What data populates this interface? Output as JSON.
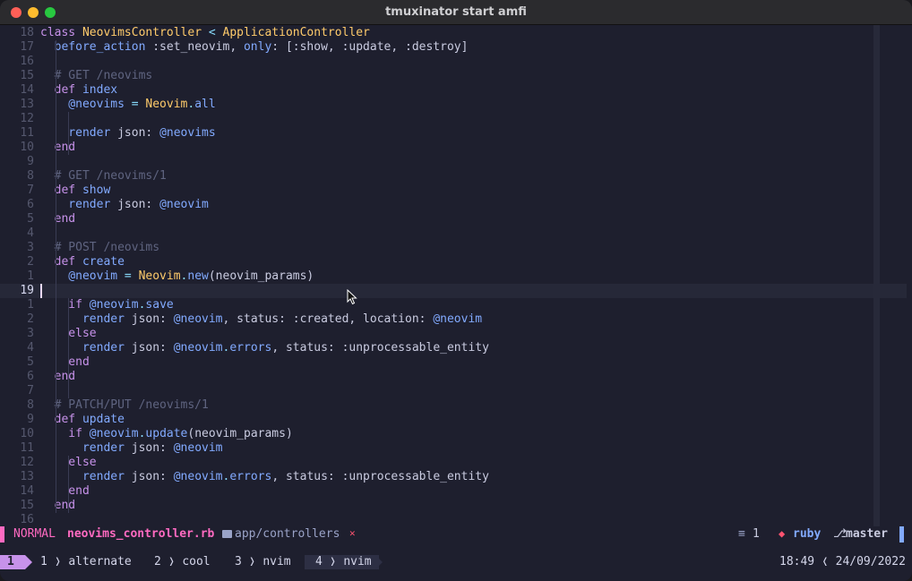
{
  "window": {
    "title": "tmuxinator start amfi"
  },
  "editor": {
    "lines": [
      {
        "num": "18",
        "parts": [
          [
            "kw",
            "class "
          ],
          [
            "cls",
            "NeovimsController "
          ],
          [
            "op",
            "< "
          ],
          [
            "cls",
            "ApplicationController"
          ]
        ]
      },
      {
        "num": "17",
        "parts": [
          [
            "plain",
            "  "
          ],
          [
            "meth",
            "before_action "
          ],
          [
            "sym",
            ":set_neovim"
          ],
          [
            "plain",
            ", "
          ],
          [
            "meth",
            "only"
          ],
          [
            "plain",
            ": [:show, :update, :destroy]"
          ]
        ]
      },
      {
        "num": "16",
        "parts": []
      },
      {
        "num": "15",
        "parts": [
          [
            "cmt",
            "  # GET /neovims"
          ]
        ]
      },
      {
        "num": "14",
        "parts": [
          [
            "kw",
            "  def "
          ],
          [
            "meth",
            "index"
          ]
        ]
      },
      {
        "num": "13",
        "parts": [
          [
            "ivar",
            "    @neovims "
          ],
          [
            "op",
            "= "
          ],
          [
            "cls",
            "Neovim"
          ],
          [
            "op",
            "."
          ],
          [
            "meth",
            "all"
          ]
        ]
      },
      {
        "num": "12",
        "parts": []
      },
      {
        "num": "11",
        "parts": [
          [
            "meth",
            "    render "
          ],
          [
            "plain",
            "json: "
          ],
          [
            "ivar",
            "@neovims"
          ]
        ]
      },
      {
        "num": "10",
        "parts": [
          [
            "kw",
            "  end"
          ]
        ]
      },
      {
        "num": "9",
        "parts": []
      },
      {
        "num": "8",
        "parts": [
          [
            "cmt",
            "  # GET /neovims/1"
          ]
        ]
      },
      {
        "num": "7",
        "parts": [
          [
            "kw",
            "  def "
          ],
          [
            "meth",
            "show"
          ]
        ]
      },
      {
        "num": "6",
        "parts": [
          [
            "meth",
            "    render "
          ],
          [
            "plain",
            "json: "
          ],
          [
            "ivar",
            "@neovim"
          ]
        ]
      },
      {
        "num": "5",
        "parts": [
          [
            "kw",
            "  end"
          ]
        ]
      },
      {
        "num": "4",
        "parts": []
      },
      {
        "num": "3",
        "parts": [
          [
            "cmt",
            "  # POST /neovims"
          ]
        ]
      },
      {
        "num": "2",
        "parts": [
          [
            "kw",
            "  def "
          ],
          [
            "meth",
            "create"
          ]
        ]
      },
      {
        "num": "1",
        "parts": [
          [
            "ivar",
            "    @neovim "
          ],
          [
            "op",
            "= "
          ],
          [
            "cls",
            "Neovim"
          ],
          [
            "op",
            "."
          ],
          [
            "meth",
            "new"
          ],
          [
            "plain",
            "(neovim_params)"
          ]
        ]
      },
      {
        "num": "19",
        "parts": [],
        "current": true
      },
      {
        "num": "1",
        "parts": [
          [
            "kw",
            "    if "
          ],
          [
            "ivar",
            "@neovim"
          ],
          [
            "op",
            "."
          ],
          [
            "meth",
            "save"
          ]
        ]
      },
      {
        "num": "2",
        "parts": [
          [
            "meth",
            "      render "
          ],
          [
            "plain",
            "json: "
          ],
          [
            "ivar",
            "@neovim"
          ],
          [
            "plain",
            ", status: :created, location: "
          ],
          [
            "ivar",
            "@neovim"
          ]
        ]
      },
      {
        "num": "3",
        "parts": [
          [
            "kw",
            "    else"
          ]
        ]
      },
      {
        "num": "4",
        "parts": [
          [
            "meth",
            "      render "
          ],
          [
            "plain",
            "json: "
          ],
          [
            "ivar",
            "@neovim"
          ],
          [
            "op",
            "."
          ],
          [
            "meth",
            "errors"
          ],
          [
            "plain",
            ", status: :unprocessable_entity"
          ]
        ]
      },
      {
        "num": "5",
        "parts": [
          [
            "kw",
            "    end"
          ]
        ]
      },
      {
        "num": "6",
        "parts": [
          [
            "kw",
            "  end"
          ]
        ]
      },
      {
        "num": "7",
        "parts": []
      },
      {
        "num": "8",
        "parts": [
          [
            "cmt",
            "  # PATCH/PUT /neovims/1"
          ]
        ]
      },
      {
        "num": "9",
        "parts": [
          [
            "kw",
            "  def "
          ],
          [
            "meth",
            "update"
          ]
        ]
      },
      {
        "num": "10",
        "parts": [
          [
            "kw",
            "    if "
          ],
          [
            "ivar",
            "@neovim"
          ],
          [
            "op",
            "."
          ],
          [
            "meth",
            "update"
          ],
          [
            "plain",
            "(neovim_params)"
          ]
        ]
      },
      {
        "num": "11",
        "parts": [
          [
            "meth",
            "      render "
          ],
          [
            "plain",
            "json: "
          ],
          [
            "ivar",
            "@neovim"
          ]
        ]
      },
      {
        "num": "12",
        "parts": [
          [
            "kw",
            "    else"
          ]
        ]
      },
      {
        "num": "13",
        "parts": [
          [
            "meth",
            "      render "
          ],
          [
            "plain",
            "json: "
          ],
          [
            "ivar",
            "@neovim"
          ],
          [
            "op",
            "."
          ],
          [
            "meth",
            "errors"
          ],
          [
            "plain",
            ", status: :unprocessable_entity"
          ]
        ]
      },
      {
        "num": "14",
        "parts": [
          [
            "kw",
            "    end"
          ]
        ]
      },
      {
        "num": "15",
        "parts": [
          [
            "kw",
            "  end"
          ]
        ]
      },
      {
        "num": "16",
        "parts": []
      }
    ]
  },
  "statusline": {
    "mode": "NORMAL",
    "filename": "neovims_controller.rb",
    "path": "app/controllers",
    "buffer_count": "1",
    "filetype": "ruby",
    "branch": "master"
  },
  "tmux": {
    "session": "1",
    "windows": [
      {
        "index": "1",
        "name": "alternate"
      },
      {
        "index": "2",
        "name": "cool"
      },
      {
        "index": "3",
        "name": "nvim"
      },
      {
        "index": "4",
        "name": "nvim",
        "active": true
      }
    ],
    "time": "18:49",
    "date": "24/09/2022"
  },
  "colors": {
    "mode": "#ff6ac1",
    "keyword": "#c792ea",
    "class": "#ffcb6b",
    "ivar": "#82aaff",
    "comment": "#5f6480"
  },
  "icons": [
    "mouse-pointer-icon",
    "folder-icon",
    "bell-slash-icon",
    "buffer-icon",
    "ruby-icon",
    "git-branch-icon"
  ]
}
